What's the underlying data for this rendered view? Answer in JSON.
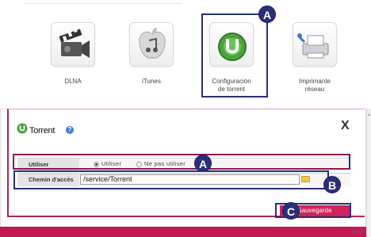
{
  "top_text": "...................................................",
  "apps": [
    {
      "label": "DLNA",
      "icon": "dlna-icon"
    },
    {
      "label": "iTunes",
      "icon": "itunes-icon"
    },
    {
      "label": "Configuración\nde torrent",
      "icon": "torrent-icon"
    },
    {
      "label": "Imprimante\nréseau",
      "icon": "printer-icon"
    }
  ],
  "callouts": {
    "a_top": "A",
    "a_row": "A",
    "b": "B",
    "c": "C"
  },
  "dialog": {
    "title": "Torrent",
    "help": "?",
    "close": "X",
    "utiliser_label": "Utiliser",
    "radio_on": "Utiliser",
    "radio_off": "Ne pas utiliser",
    "chemin_label": "Chemin d'accès",
    "path_value": "/service/Torrent",
    "save_label": "Sauvegarde"
  },
  "close_hint": "close",
  "colors": {
    "accent": "#d1245a",
    "callout": "#2a2f7a",
    "bar": "#c5174f"
  }
}
